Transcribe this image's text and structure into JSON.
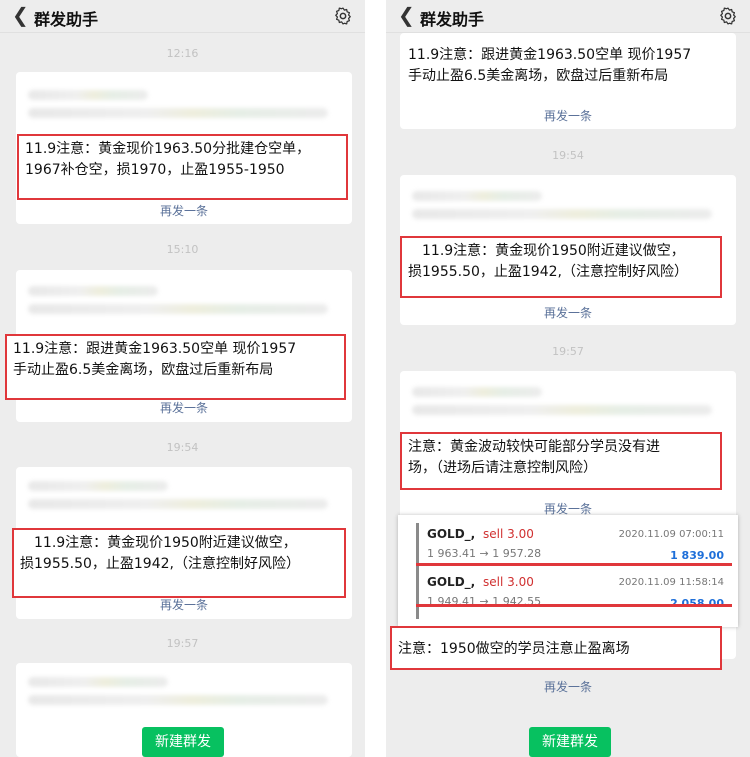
{
  "app": {
    "title": "群发助手",
    "back_icon": "chevron-left-icon",
    "settings_icon": "gear-icon"
  },
  "left": {
    "times": [
      "12:16",
      "15:10",
      "19:54",
      "19:57"
    ],
    "messages": [
      "11.9注意：黄金现价1963.50分批建仓空单，\n1967补仓空，损1970，止盈1955-1950",
      "11.9注意：跟进黄金1963.50空单 现价1957\n手动止盈6.5美金离场，欧盘过后重新布局",
      "　11.9注意：黄金现价1950附近建议做空，\n损1955.50，止盈1942,（注意控制好风险）"
    ],
    "resend": "再发一条",
    "new_button": "新建群发"
  },
  "right": {
    "times": [
      "19:54",
      "19:57"
    ],
    "messages": [
      "11.9注意：跟进黄金1963.50空单 现价1957\n手动止盈6.5美金离场，欧盘过后重新布局",
      "　11.9注意：黄金现价1950附近建议做空，\n损1955.50，止盈1942,（注意控制好风险）",
      "注意：黄金波动较快可能部分学员没有进\n场，（进场后请注意控制风险）",
      "注意：1950做空的学员注意止盈离场"
    ],
    "resend": "再发一条",
    "trades": [
      {
        "symbol": "GOLD_,",
        "action": "sell 3.00",
        "datetime": "2020.11.09 07:00:11",
        "prices": "1 963.41 → 1 957.28",
        "profit": "1 839.00"
      },
      {
        "symbol": "GOLD_,",
        "action": "sell 3.00",
        "datetime": "2020.11.09 11:58:14",
        "prices": "1 949.41 → 1 942.55",
        "profit": "2 058.00"
      }
    ],
    "new_button": "新建群发"
  }
}
